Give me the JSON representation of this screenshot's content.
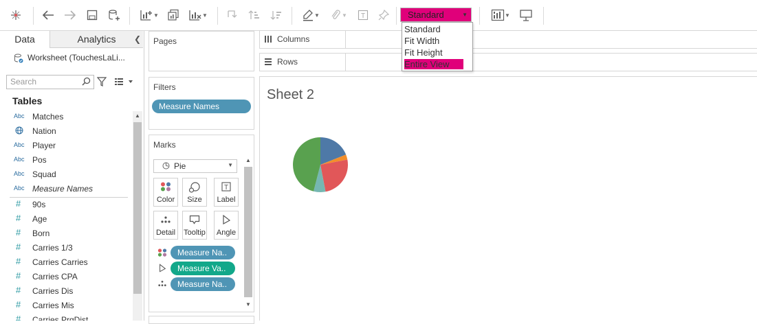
{
  "toolbar": {
    "fit_dropdown": {
      "selected": "Standard",
      "options": [
        "Standard",
        "Fit Width",
        "Fit Height",
        "Entire View"
      ],
      "highlighted": "Entire View"
    }
  },
  "data_pane": {
    "tabs": [
      "Data",
      "Analytics"
    ],
    "data_source": "Worksheet (TouchesLaLi...",
    "search_placeholder": "Search",
    "tables_heading": "Tables",
    "dimensions": [
      {
        "icon": "Abc",
        "name": "Matches"
      },
      {
        "icon": "globe",
        "name": "Nation"
      },
      {
        "icon": "Abc",
        "name": "Player"
      },
      {
        "icon": "Abc",
        "name": "Pos"
      },
      {
        "icon": "Abc",
        "name": "Squad"
      },
      {
        "icon": "Abc",
        "name": "Measure Names"
      }
    ],
    "measures": [
      {
        "icon": "#",
        "name": "90s"
      },
      {
        "icon": "#",
        "name": "Age"
      },
      {
        "icon": "#",
        "name": "Born"
      },
      {
        "icon": "#",
        "name": "Carries 1/3"
      },
      {
        "icon": "#",
        "name": "Carries Carries"
      },
      {
        "icon": "#",
        "name": "Carries CPA"
      },
      {
        "icon": "#",
        "name": "Carries Dis"
      },
      {
        "icon": "#",
        "name": "Carries Mis"
      },
      {
        "icon": "#",
        "name": "Carries PrgDist"
      }
    ]
  },
  "shelves": {
    "pages_title": "Pages",
    "filters_title": "Filters",
    "filter_pill": "Measure Names",
    "marks_title": "Marks",
    "mark_type": "Pie",
    "mark_buttons": [
      "Color",
      "Size",
      "Label",
      "Detail",
      "Tooltip",
      "Angle"
    ],
    "mark_pills": [
      {
        "icon": "color",
        "label": "Measure Na..",
        "color": "#4f95b5"
      },
      {
        "icon": "angle",
        "label": "Measure Va..",
        "color": "#12a88a"
      },
      {
        "icon": "detail",
        "label": "Measure Na..",
        "color": "#4f95b5"
      }
    ],
    "columns_label": "Columns",
    "rows_label": "Rows"
  },
  "view": {
    "sheet_title": "Sheet 2"
  },
  "chart_data": {
    "type": "pie",
    "slices": [
      {
        "value": 19,
        "color": "#4e79a7"
      },
      {
        "value": 3,
        "color": "#f28e2b"
      },
      {
        "value": 25,
        "color": "#e15759"
      },
      {
        "value": 7,
        "color": "#76b7b2"
      },
      {
        "value": 46,
        "color": "#59a14f"
      }
    ]
  }
}
